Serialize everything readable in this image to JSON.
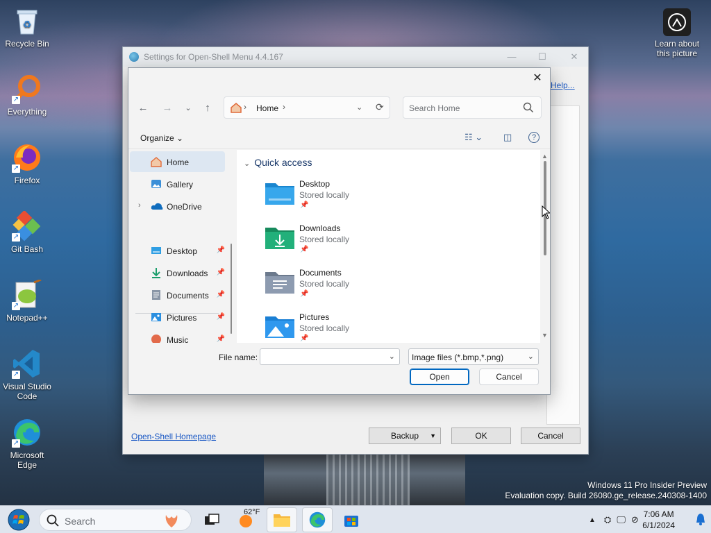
{
  "desktop": {
    "icons": [
      {
        "label": "Recycle Bin",
        "icon": "recycle-bin-icon"
      },
      {
        "label": "Everything",
        "icon": "everything-search-icon"
      },
      {
        "label": "Firefox",
        "icon": "firefox-icon"
      },
      {
        "label": "Git Bash",
        "icon": "git-bash-icon"
      },
      {
        "label": "Notepad++",
        "icon": "notepad-plus-plus-icon"
      },
      {
        "label": "Visual Studio Code",
        "icon": "vscode-icon"
      },
      {
        "label": "Microsoft Edge",
        "icon": "edge-icon"
      }
    ],
    "learn_about": "Learn about this picture",
    "watermark_line1": "Windows 11 Pro Insider Preview",
    "watermark_line2": "Evaluation copy. Build 26080.ge_release.240308-1400"
  },
  "settings_window": {
    "title": "Settings for Open-Shell Menu 4.4.167",
    "help_link": "Help...",
    "homepage_link": "Open-Shell Homepage",
    "backup_label": "Backup",
    "ok_label": "OK",
    "cancel_label": "Cancel"
  },
  "dialog": {
    "close_glyph": "✕",
    "address": {
      "crumb": "Home"
    },
    "search_placeholder": "Search Home",
    "organize_label": "Organize ⌄",
    "nav": [
      {
        "label": "Home",
        "icon": "home-icon",
        "selected": true
      },
      {
        "label": "Gallery",
        "icon": "gallery-icon"
      },
      {
        "label": "OneDrive",
        "icon": "onedrive-icon",
        "expandable": true
      },
      {
        "label": "Desktop",
        "icon": "desktop-folder-icon",
        "pinned": true
      },
      {
        "label": "Downloads",
        "icon": "downloads-icon",
        "pinned": true
      },
      {
        "label": "Documents",
        "icon": "documents-icon",
        "pinned": true
      },
      {
        "label": "Pictures",
        "icon": "pictures-icon",
        "pinned": true
      },
      {
        "label": "Music",
        "icon": "music-icon",
        "pinned": true
      }
    ],
    "quick_access_label": "Quick access",
    "folders": [
      {
        "name": "Desktop",
        "status": "Stored locally",
        "icon": "desktop-folder-icon"
      },
      {
        "name": "Downloads",
        "status": "Stored locally",
        "icon": "downloads-folder-icon"
      },
      {
        "name": "Documents",
        "status": "Stored locally",
        "icon": "documents-folder-icon"
      },
      {
        "name": "Pictures",
        "status": "Stored locally",
        "icon": "pictures-folder-icon"
      }
    ],
    "file_name_label": "File name:",
    "file_name_value": "",
    "file_type": "Image files (*.bmp,*.png)",
    "open_label": "Open",
    "cancel_label": "Cancel"
  },
  "taskbar": {
    "search_placeholder": "Search",
    "weather": "62°F",
    "time": "7:06 AM",
    "date": "6/1/2024"
  },
  "colors": {
    "accent": "#0067c0",
    "link": "#1a58c4",
    "selection": "#dde7f2"
  }
}
